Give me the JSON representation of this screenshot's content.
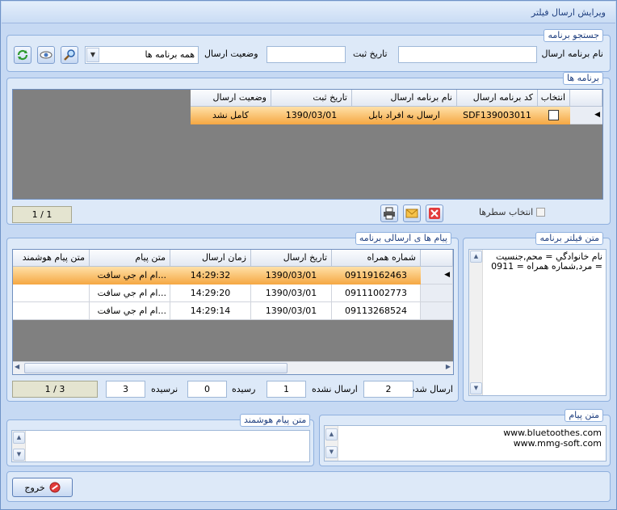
{
  "window": {
    "title": "ویرایش ارسال فیلتر"
  },
  "search": {
    "group_title": "جستجو برنامه",
    "name_label": "نام برنامه ارسال",
    "name_value": "",
    "date_label": "تاریخ ثبت",
    "date_value": "",
    "status_label": "وضعیت ارسال",
    "status_value": "همه برنامه ها",
    "refresh_icon": "refresh-icon",
    "eye_icon": "eye-icon",
    "search_icon": "magnifier-icon"
  },
  "programs": {
    "group_title": "برنامه ها",
    "columns": [
      "انتخاب",
      "کد برنامه ارسال",
      "نام برنامه ارسال",
      "تاریخ ثبت",
      "وضعیت ارسال"
    ],
    "rows": [
      {
        "select": false,
        "code": "SDF139003011",
        "name": "ارسال به افراد بابل",
        "date": "1390/03/01",
        "status": "کامل نشد"
      }
    ],
    "select_rows_label": "انتخاب سطرها",
    "pager": "1 / 1"
  },
  "messages": {
    "group_title": "پیام ها ی ارسالی برنامه",
    "columns": [
      "شماره همراه",
      "تاریخ ارسال",
      "زمان ارسال",
      "متن پیام",
      "متن پیام هوشمند"
    ],
    "rows": [
      {
        "phone": "09119162463",
        "date": "1390/03/01",
        "time": "14:29:32",
        "text": "ام ام جي سافت...",
        "smart": ""
      },
      {
        "phone": "09111002773",
        "date": "1390/03/01",
        "time": "14:29:20",
        "text": "ام ام جي سافت...",
        "smart": ""
      },
      {
        "phone": "09113268524",
        "date": "1390/03/01",
        "time": "14:29:14",
        "text": "ام ام جي سافت...",
        "smart": ""
      }
    ],
    "sent_label": "ارسال شده",
    "sent_value": "2",
    "not_sent_label": "ارسال نشده",
    "not_sent_value": "1",
    "received_label": "رسیده",
    "received_value": "0",
    "not_received_label": "نرسیده",
    "not_received_value": "3",
    "pager": "1 / 3"
  },
  "filter": {
    "group_title": "متن فیلتر برنامه",
    "line1": "نام خانوادگي = محم,جنسيت",
    "line2": "= مرد,شماره همراه = 0911"
  },
  "smart_text": {
    "group_title": "متن پیام هوشمند",
    "value": ""
  },
  "message_text": {
    "group_title": "متن پیام",
    "line1": "www.bluetoothes.com",
    "line2": "www.mmg-soft.com"
  },
  "footer": {
    "exit_label": "خروج"
  },
  "colors": {
    "selected_row_top": "#ffd89a",
    "selected_row_bottom": "#f5a742",
    "window_bg": "#c6d9f3"
  }
}
